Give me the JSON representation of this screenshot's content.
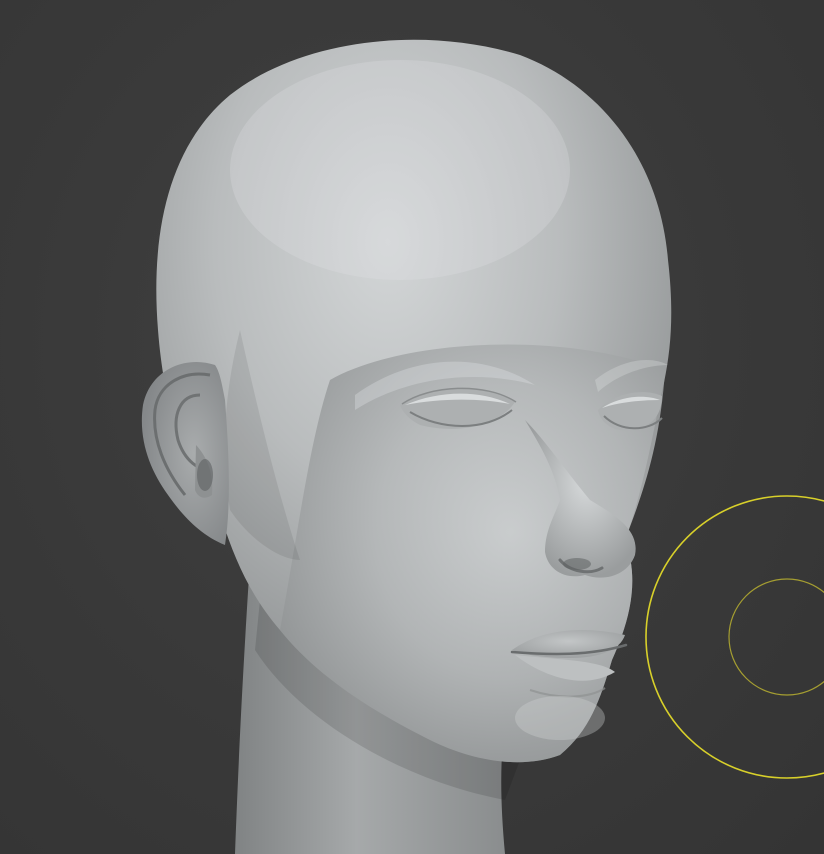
{
  "viewport": {
    "background_color": "#3a3a3a"
  },
  "model": {
    "name": "sculpt-head",
    "material_color": "#b9bcbd"
  },
  "brush_cursor": {
    "color": "#d8d02a"
  }
}
